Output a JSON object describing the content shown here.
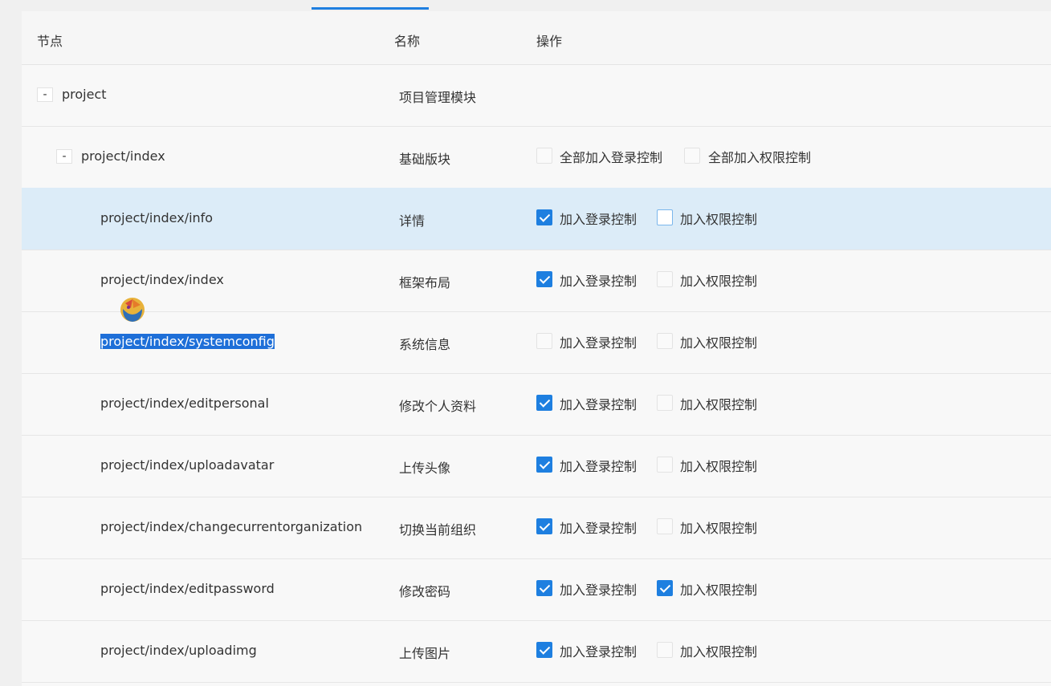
{
  "header": {
    "node": "节点",
    "name": "名称",
    "action": "操作"
  },
  "rows": [
    {
      "node": "project",
      "name": "项目管理模块",
      "toggle": "-"
    },
    {
      "node": "project/index",
      "name": "基础版块",
      "toggle": "-",
      "login_label": "全部加入登录控制",
      "auth_label": "全部加入权限控制",
      "login_checked": false,
      "auth_checked": false
    },
    {
      "node": "project/index/info",
      "name": "详情",
      "login_label": "加入登录控制",
      "auth_label": "加入权限控制",
      "login_checked": true,
      "auth_checked": false
    },
    {
      "node": "project/index/index",
      "name": "框架布局",
      "login_label": "加入登录控制",
      "auth_label": "加入权限控制",
      "login_checked": true,
      "auth_checked": false
    },
    {
      "node": "project/index/systemconfig",
      "name": "系统信息",
      "login_label": "加入登录控制",
      "auth_label": "加入权限控制",
      "login_checked": false,
      "auth_checked": false
    },
    {
      "node": "project/index/editpersonal",
      "name": "修改个人资料",
      "login_label": "加入登录控制",
      "auth_label": "加入权限控制",
      "login_checked": true,
      "auth_checked": false
    },
    {
      "node": "project/index/uploadavatar",
      "name": "上传头像",
      "login_label": "加入登录控制",
      "auth_label": "加入权限控制",
      "login_checked": true,
      "auth_checked": false
    },
    {
      "node": "project/index/changecurrentorganization",
      "name": "切换当前组织",
      "login_label": "加入登录控制",
      "auth_label": "加入权限控制",
      "login_checked": true,
      "auth_checked": false
    },
    {
      "node": "project/index/editpassword",
      "name": "修改密码",
      "login_label": "加入登录控制",
      "auth_label": "加入权限控制",
      "login_checked": true,
      "auth_checked": true
    },
    {
      "node": "project/index/uploadimg",
      "name": "上传图片",
      "login_label": "加入登录控制",
      "auth_label": "加入权限控制",
      "login_checked": true,
      "auth_checked": false
    }
  ],
  "colors": {
    "accent": "#1e7fe0",
    "selected_row": "#dcecf8",
    "text_highlight": "#1e6fd8"
  },
  "icons": {
    "cursor": "app-cursor-icon"
  }
}
